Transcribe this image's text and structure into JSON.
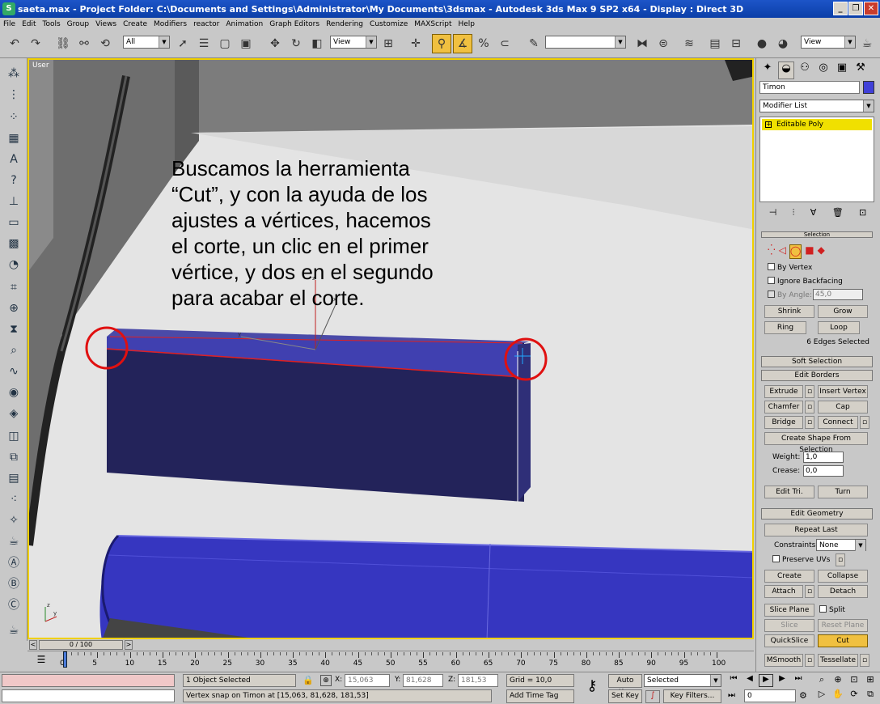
{
  "window": {
    "title": "saeta.max   - Project Folder: C:\\Documents and Settings\\Administrator\\My Documents\\3dsmax    - Autodesk 3ds Max 9 SP2 x64    - Display : Direct 3D"
  },
  "menu": [
    "File",
    "Edit",
    "Tools",
    "Group",
    "Views",
    "Create",
    "Modifiers",
    "reactor",
    "Animation",
    "Graph Editors",
    "Rendering",
    "Customize",
    "MAXScript",
    "Help"
  ],
  "toolbar": {
    "selection_filter": "All",
    "ref_coord": "View",
    "named_selection": "",
    "view_dd": "View"
  },
  "viewport": {
    "label": "User",
    "annotation": [
      "Buscamos la herramienta",
      "“Cut”, y con la ayuda de los",
      "ajustes a vértices, hacemos",
      "el corte, un clic en el primer",
      "vértice, y dos en el segundo",
      "para acabar el corte."
    ]
  },
  "panel": {
    "object_name": "Timon",
    "modifier_list": "Modifier List",
    "stack_item": "Editable Poly",
    "selection": {
      "title": "Selection",
      "by_vertex": "By Vertex",
      "ignore_backfacing": "Ignore Backfacing",
      "by_angle": "By Angle:",
      "angle_value": "45,0",
      "shrink": "Shrink",
      "grow": "Grow",
      "ring": "Ring",
      "loop": "Loop",
      "status": "6 Edges Selected"
    },
    "soft_selection": "Soft Selection",
    "edit_borders": {
      "title": "Edit Borders",
      "extrude": "Extrude",
      "insert_vertex": "Insert Vertex",
      "chamfer": "Chamfer",
      "cap": "Cap",
      "bridge": "Bridge",
      "connect": "Connect",
      "create_shape": "Create Shape From Selection",
      "weight_label": "Weight:",
      "weight_value": "1,0",
      "crease_label": "Crease:",
      "crease_value": "0,0",
      "edit_tri": "Edit Tri.",
      "turn": "Turn"
    },
    "edit_geometry": {
      "title": "Edit Geometry",
      "repeat_last": "Repeat Last",
      "constraints_label": "Constraints:",
      "constraints_value": "None",
      "preserve_uvs": "Preserve UVs",
      "create": "Create",
      "collapse": "Collapse",
      "attach": "Attach",
      "detach": "Detach",
      "slice_plane": "Slice Plane",
      "split": "Split",
      "slice": "Slice",
      "reset_plane": "Reset Plane",
      "quickslice": "QuickSlice",
      "cut": "Cut",
      "msmooth": "MSmooth",
      "tessellate": "Tessellate"
    }
  },
  "timeline": {
    "frame": "0 / 100",
    "ticks": [
      "0",
      "5",
      "10",
      "15",
      "20",
      "25",
      "30",
      "35",
      "40",
      "45",
      "50",
      "55",
      "60",
      "65",
      "70",
      "75",
      "80",
      "85",
      "90",
      "95",
      "100"
    ]
  },
  "status": {
    "objects_selected": "1 Object Selected",
    "prompt": "Vertex snap on Timon at [15,063, 81,628, 181,53]",
    "x_label": "X:",
    "x": "15,063",
    "y_label": "Y:",
    "y": "81,628",
    "z_label": "Z:",
    "z": "181,53",
    "grid": "Grid = 10,0",
    "add_time_tag": "Add Time Tag",
    "auto_key": "Auto Key",
    "set_key": "Set Key",
    "selected": "Selected",
    "key_filters": "Key Filters...",
    "frame_field": "0"
  },
  "colors": {
    "accent_yellow": "#f0d000",
    "object_blue": "#3b3bb8",
    "titlebar": "#0b3ea8"
  }
}
